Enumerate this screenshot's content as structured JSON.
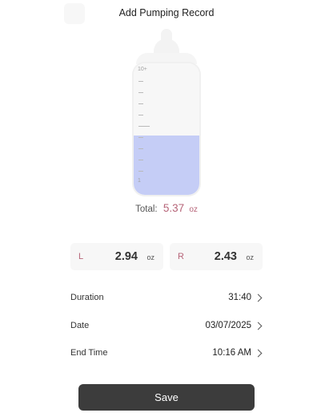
{
  "header": {
    "title": "Add Pumping Record"
  },
  "bottle": {
    "max_label": "10+",
    "min_label": "1",
    "fill_level": 0.45,
    "fill_color": "#c5cdf6"
  },
  "total": {
    "label": "Total:",
    "value": "5.37",
    "unit": "oz",
    "accent_color": "#b66478"
  },
  "left": {
    "letter": "L",
    "amount": "2.94",
    "unit": "oz"
  },
  "right": {
    "letter": "R",
    "amount": "2.43",
    "unit": "oz"
  },
  "details": {
    "duration": {
      "label": "Duration",
      "value": "31:40"
    },
    "date": {
      "label": "Date",
      "value": "03/07/2025"
    },
    "end_time": {
      "label": "End Time",
      "value": "10:16 AM"
    }
  },
  "actions": {
    "save_label": "Save"
  }
}
